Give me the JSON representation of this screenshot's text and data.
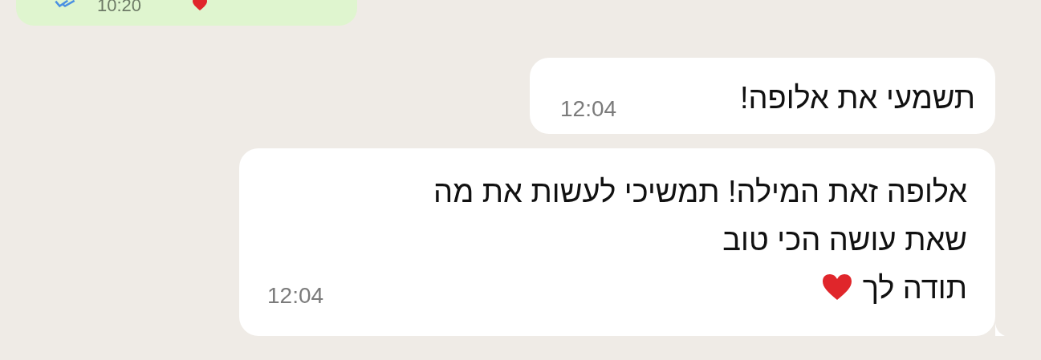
{
  "messages": [
    {
      "kind": "outgoing",
      "read": true,
      "time": "10:20",
      "ends_with_heart": true
    },
    {
      "kind": "incoming",
      "text": "תשמעי את אלופה!",
      "time": "12:04",
      "ends_with_heart": false,
      "tail": false
    },
    {
      "kind": "incoming",
      "text": "אלופה זאת המילה! תמשיכי לעשות את מה\nשאת עושה הכי טוב\nתודה לך",
      "time": "12:04",
      "ends_with_heart": true,
      "tail": true
    }
  ]
}
